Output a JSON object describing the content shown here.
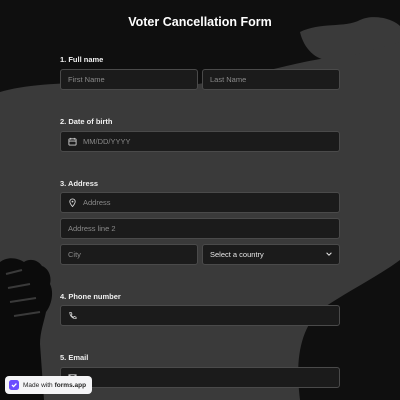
{
  "form": {
    "title": "Voter Cancellation Form",
    "questions": [
      {
        "number_label": "1.  Full name",
        "fields": [
          {
            "placeholder": "First Name"
          },
          {
            "placeholder": "Last Name"
          }
        ]
      },
      {
        "number_label": "2.  Date of birth",
        "fields": [
          {
            "placeholder": "MM/DD/YYYY",
            "icon": "calendar-icon"
          }
        ]
      },
      {
        "number_label": "3.  Address",
        "fields": [
          {
            "placeholder": "Address",
            "icon": "location-pin-icon"
          },
          {
            "placeholder": "Address line 2"
          },
          {
            "placeholder": "City"
          },
          {
            "value": "Select a country",
            "icon": "chevron-down-icon"
          }
        ]
      },
      {
        "number_label": "4.  Phone number",
        "fields": [
          {
            "placeholder": "",
            "icon": "phone-icon"
          }
        ]
      },
      {
        "number_label": "5.  Email",
        "fields": [
          {
            "placeholder": "",
            "icon": "mail-icon"
          }
        ]
      }
    ]
  },
  "badge": {
    "prefix": "Made with",
    "brand": "forms.app"
  },
  "colors": {
    "background": "#0f0f0f",
    "brush": "#3a3a3a",
    "field_bg": "#1b1b1b",
    "field_border": "#4a4a4a",
    "badge_accent": "#6b4cff"
  }
}
